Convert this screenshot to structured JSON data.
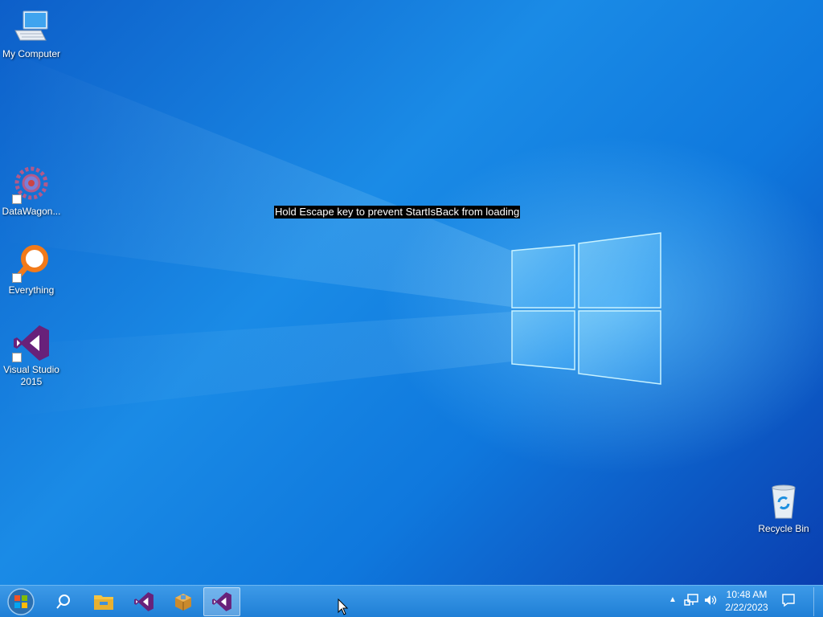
{
  "desktop": {
    "icons": [
      {
        "label": "My Computer",
        "icon": "computer-icon"
      },
      {
        "label": "DataWagon...",
        "icon": "datawagon-icon"
      },
      {
        "label": "Everything",
        "icon": "everything-search-icon"
      },
      {
        "label": "Visual Studio 2015",
        "icon": "visual-studio-icon"
      },
      {
        "label": "Recycle Bin",
        "icon": "recycle-bin-icon"
      }
    ],
    "notice": "Hold Escape key to prevent StartIsBack from loading"
  },
  "taskbar": {
    "start": {
      "icon": "windows-orb-icon"
    },
    "pinned": [
      {
        "icon": "search-icon"
      },
      {
        "icon": "file-explorer-icon"
      },
      {
        "icon": "visual-studio-icon"
      },
      {
        "icon": "package-box-icon"
      },
      {
        "icon": "visual-studio-icon",
        "active": true
      }
    ],
    "tray": {
      "time": "10:48 AM",
      "date": "2/22/2023",
      "icons": [
        "show-hidden-icons-chevron-icon",
        "network-icon",
        "volume-icon",
        "action-center-icon"
      ]
    }
  },
  "colors": {
    "accent": "#1f7fd6",
    "vs_purple": "#68217a"
  }
}
